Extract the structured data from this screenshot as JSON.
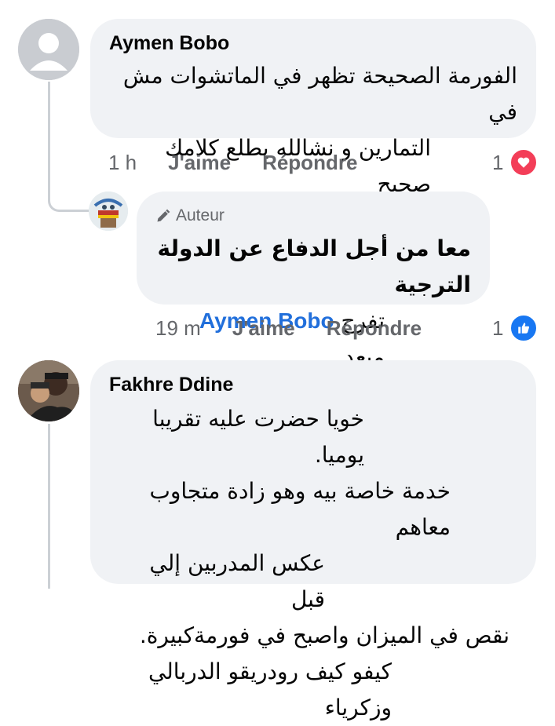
{
  "comments": [
    {
      "author": "Aymen Bobo",
      "lines": [
        "الفورمة الصحيحة تظهر في الماتشوات مش في",
        "التمارين و نشالله يطلع كلامك صحيح"
      ],
      "time": "1 h",
      "like_label": "J'aime",
      "reply_label": "Répondre",
      "reaction_count": "1",
      "reaction_icon": "heart-icon",
      "reaction_color": "#f33e58"
    },
    {
      "badge_label": "Auteur",
      "badge_icon": "pencil-icon",
      "line1": "معا من أجل الدفاع عن الدولة الترجية",
      "mention": "Aymen Bobo",
      "line2_text": "تفرج مبعد",
      "time": "19 m",
      "like_label": "J'aime",
      "reply_label": "Répondre",
      "reaction_count": "1",
      "reaction_icon": "thumbs-up-icon",
      "reaction_color": "#1877f2"
    },
    {
      "author": "Fakhre Ddine",
      "lines": [
        "خويا حضرت عليه تقريبا يوميا.",
        "خدمة خاصة بيه وهو زادة متجاوب معاهم",
        "عكس المدربين إلي قبل",
        "نقص في الميزان واصبح في فورمةكبيرة.",
        "كيفو كيف رودريقو الدربالي وزكرياء"
      ]
    }
  ]
}
